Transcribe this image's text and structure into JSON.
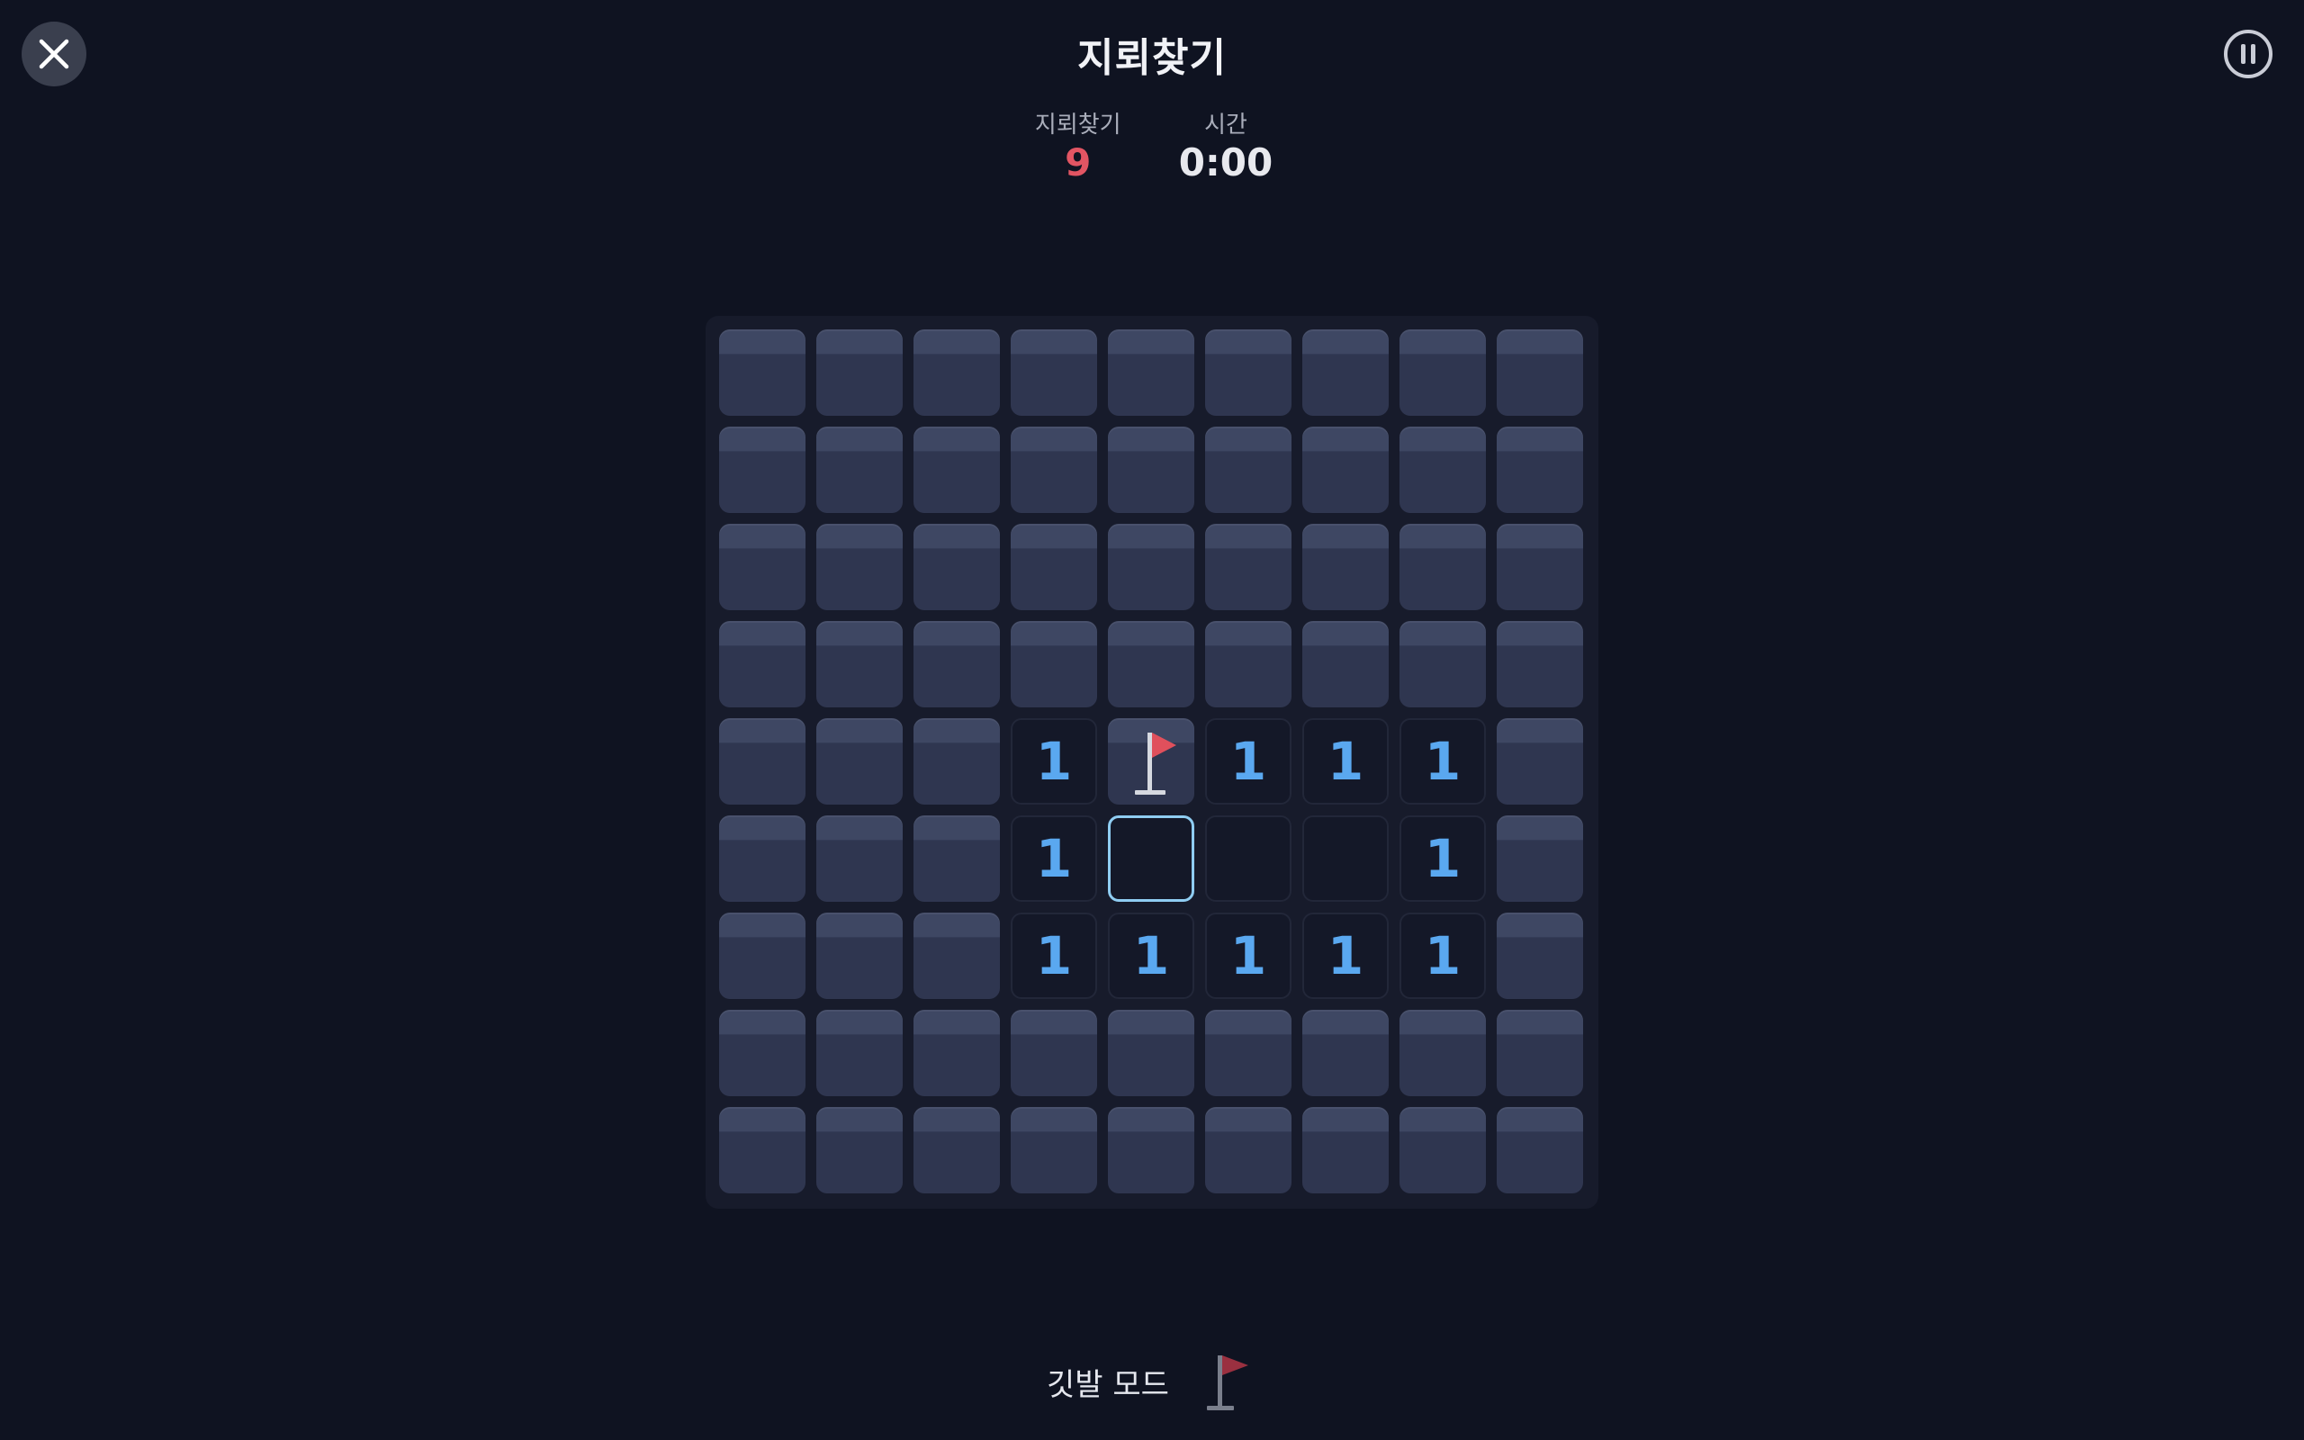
{
  "header": {
    "title": "지뢰찾기",
    "close_icon": "close-icon",
    "pause_icon": "pause-icon"
  },
  "stats": {
    "mines_label": "지뢰찾기",
    "mines_value": "9",
    "time_label": "시간",
    "time_value": "0:00"
  },
  "colors": {
    "background": "#0f1321",
    "mine_counter": "#e25563",
    "number": "#5aa8f0",
    "selection": "#8fcdf2",
    "flag": "#e0505c"
  },
  "board": {
    "rows": 9,
    "cols": 9,
    "selected": [
      5,
      4
    ],
    "cells": [
      [
        "c",
        "c",
        "c",
        "c",
        "c",
        "c",
        "c",
        "c",
        "c"
      ],
      [
        "c",
        "c",
        "c",
        "c",
        "c",
        "c",
        "c",
        "c",
        "c"
      ],
      [
        "c",
        "c",
        "c",
        "c",
        "c",
        "c",
        "c",
        "c",
        "c"
      ],
      [
        "c",
        "c",
        "c",
        "c",
        "c",
        "c",
        "c",
        "c",
        "c"
      ],
      [
        "c",
        "c",
        "c",
        "1",
        "F",
        "1",
        "1",
        "1",
        "c"
      ],
      [
        "c",
        "c",
        "c",
        "1",
        "0",
        "0",
        "0",
        "1",
        "c"
      ],
      [
        "c",
        "c",
        "c",
        "1",
        "1",
        "1",
        "1",
        "1",
        "c"
      ],
      [
        "c",
        "c",
        "c",
        "c",
        "c",
        "c",
        "c",
        "c",
        "c"
      ],
      [
        "c",
        "c",
        "c",
        "c",
        "c",
        "c",
        "c",
        "c",
        "c"
      ]
    ]
  },
  "footer": {
    "flag_mode_label": "깃발 모드",
    "flag_mode_icon": "flag-icon"
  }
}
